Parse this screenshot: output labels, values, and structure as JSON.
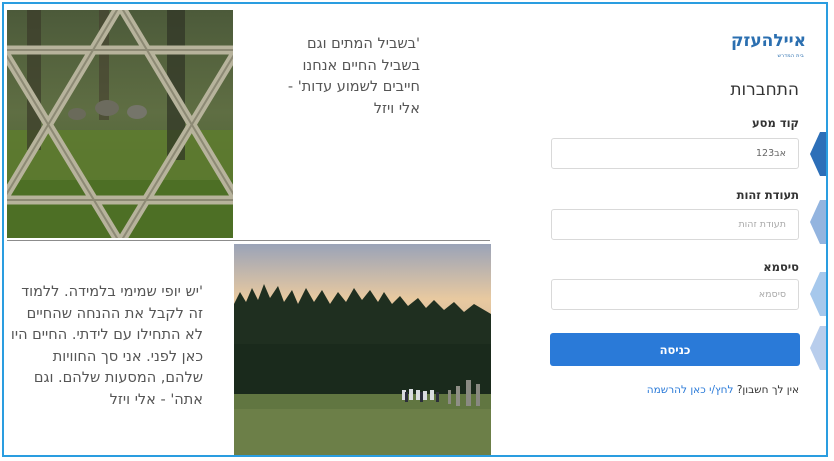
{
  "colors": {
    "accent": "#2a7ad8",
    "border": "#2a9de0",
    "tab_1": "#2d6fb8",
    "tab_2": "#93b4df",
    "tab_3": "#a6c8ec",
    "tab_4": "#b8cdec"
  },
  "quote_top": {
    "lines": [
      "'בשביל המתים וגם",
      "בשביל החיים אנחנו",
      "חייבים לשמוע עדות' -",
      "אלי ויזל"
    ]
  },
  "quote_bottom": {
    "lines": [
      "'יש יופי שמימי בלמידה. ללמוד",
      "זה לקבל את ההנחה שהחיים",
      "לא התחילו עם לידתי. החיים היו",
      "כאן לפני. אני סך החוויות",
      "שלהם, המסעות שלהם. וגם",
      "אתה' - אלי ויזל"
    ]
  },
  "logo": {
    "text": "איילהעזק",
    "sub": "בית המדרש"
  },
  "login": {
    "title": "התחברות",
    "trip_code_label": "קוד מסע",
    "trip_code_value": "אב123",
    "id_label": "תעודת זהות",
    "id_placeholder": "תעודת זהות",
    "password_label": "סיסמא",
    "password_placeholder": "סיסמא",
    "submit_label": "כניסה",
    "register_prompt": "אין לך חשבון?",
    "register_link": "לחץ/י כאן להרשמה"
  },
  "icons": [
    "star-of-david-icon",
    "step-tab-icon"
  ]
}
